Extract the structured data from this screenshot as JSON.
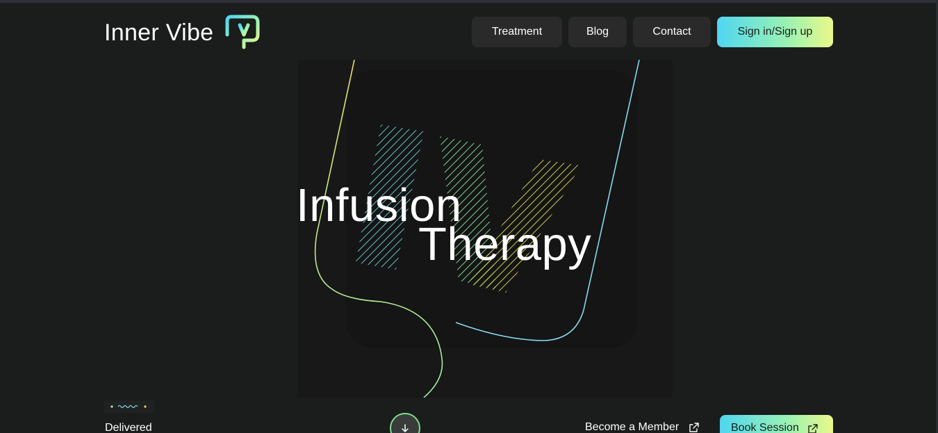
{
  "header": {
    "logo_text": "Inner Vibe",
    "logo_icon": "iv-logo-mark"
  },
  "nav": {
    "items": [
      {
        "label": "Treatment"
      },
      {
        "label": "Blog"
      },
      {
        "label": "Contact"
      }
    ],
    "signin_label": "Sign in/Sign up"
  },
  "hero": {
    "title_line1": "Infusion",
    "title_line2": "Therapy"
  },
  "footer": {
    "delivered_label": "Delivered",
    "scroll_icon": "arrow-down-icon",
    "member_label": "Become a Member",
    "book_label": "Book Session",
    "external_icon": "external-link-icon"
  },
  "colors": {
    "background": "#1b1c1c",
    "button_dark": "#2a2a2b",
    "gradient_start": "#4fd6f0",
    "gradient_mid": "#9af2b2",
    "gradient_end": "#eaf88a",
    "line_yellow": "#e8e36a",
    "line_blue": "#8ad8ee"
  }
}
